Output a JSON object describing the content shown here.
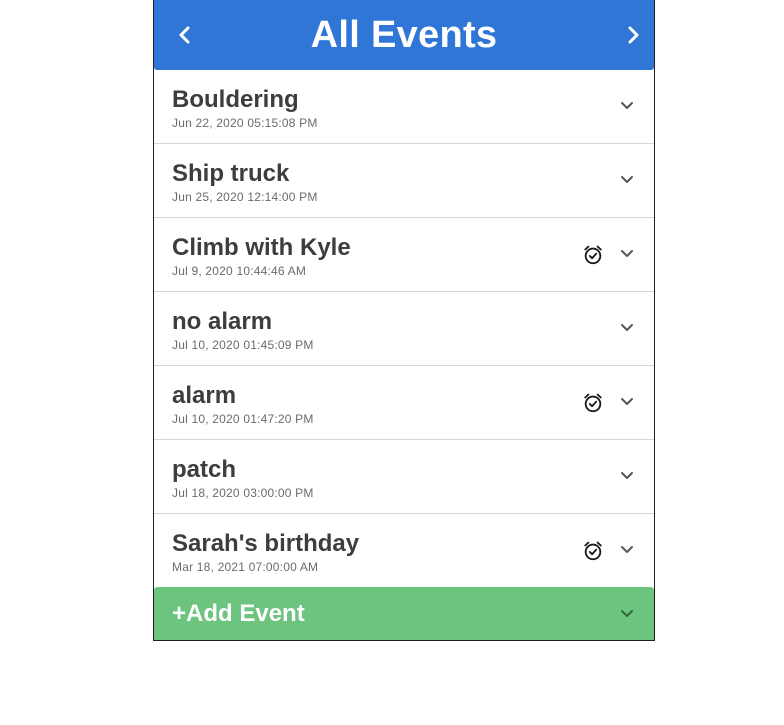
{
  "header": {
    "title": "All Events",
    "prev_icon": "chevron-left-icon",
    "next_icon": "chevron-right-icon",
    "color": "#2f76d6"
  },
  "events": [
    {
      "name": "Bouldering",
      "date": "Jun 22, 2020 05:15:08 PM",
      "alarm": false
    },
    {
      "name": "Ship truck",
      "date": "Jun 25, 2020 12:14:00 PM",
      "alarm": false
    },
    {
      "name": "Climb with Kyle",
      "date": "Jul 9, 2020 10:44:46 AM",
      "alarm": true
    },
    {
      "name": "no alarm",
      "date": "Jul 10, 2020 01:45:09 PM",
      "alarm": false
    },
    {
      "name": "alarm",
      "date": "Jul 10, 2020 01:47:20 PM",
      "alarm": true
    },
    {
      "name": "patch",
      "date": "Jul 18, 2020 03:00:00 PM",
      "alarm": false
    },
    {
      "name": "Sarah's birthday",
      "date": "Mar 18, 2021 07:00:00 AM",
      "alarm": true
    }
  ],
  "add_event": {
    "label": "+Add Event",
    "color": "#6cc47e"
  },
  "icons": {
    "alarm": "alarm-clock-check-icon",
    "expand": "chevron-down-icon"
  }
}
